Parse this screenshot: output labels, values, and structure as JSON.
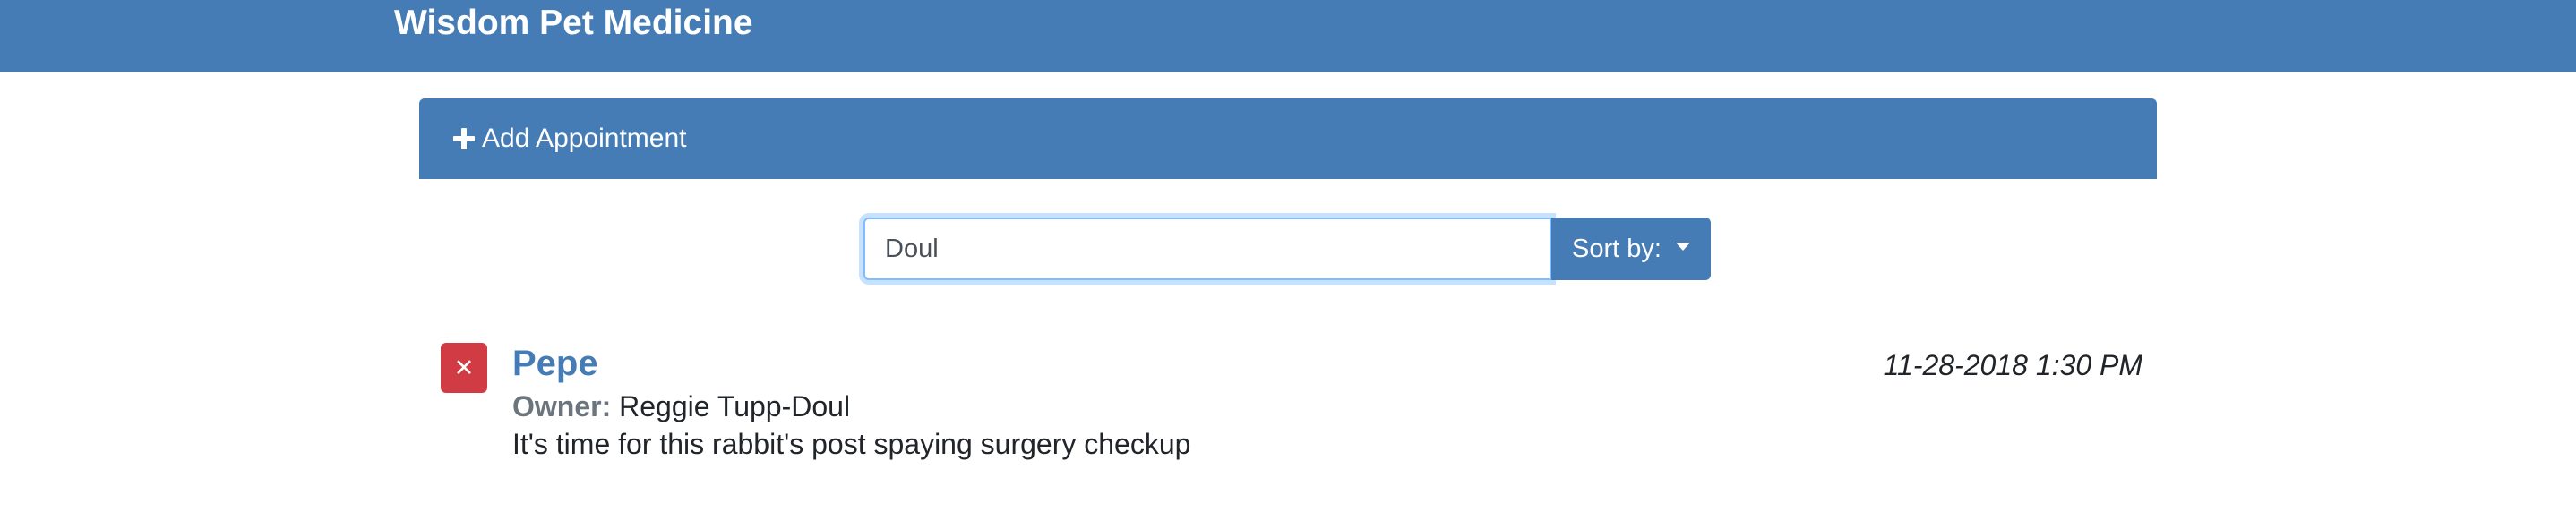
{
  "header": {
    "brand": "Wisdom Pet Medicine"
  },
  "add_appointment": {
    "icon": "plus-icon",
    "label": "Add Appointment"
  },
  "search": {
    "value": "Doul",
    "sort_label": "Sort by:",
    "sort_icon": "caret-down-icon"
  },
  "appointments": [
    {
      "pet_name": "Pepe",
      "owner_label": "Owner:",
      "owner_name": "Reggie Tupp-Doul",
      "notes": "It's time for this rabbit's post spaying surgery checkup",
      "date": "11-28-2018 1:30 PM",
      "delete_icon": "close-icon"
    }
  ],
  "colors": {
    "primary": "#467cb5",
    "danger": "#d13c44",
    "muted": "#6c757d"
  }
}
